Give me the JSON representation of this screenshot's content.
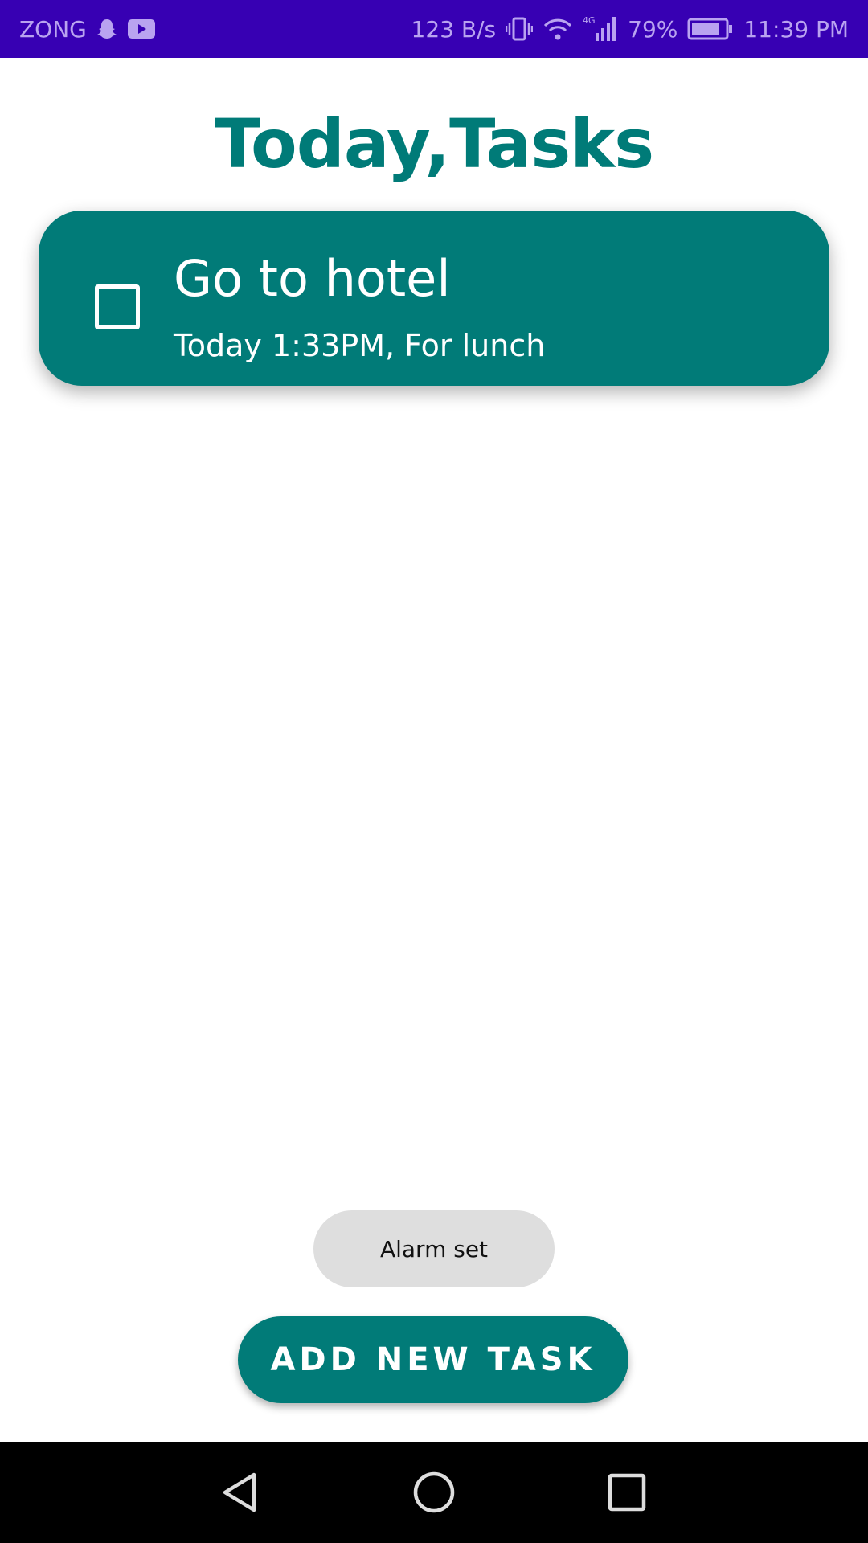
{
  "status_bar": {
    "carrier": "ZONG",
    "net_speed": "123 B/s",
    "network_type": "4G",
    "battery": "79%",
    "time": "11:39 PM",
    "icons": [
      "snapchat-icon",
      "youtube-icon",
      "vibrate-icon",
      "wifi-icon",
      "signal-icon",
      "battery-icon"
    ]
  },
  "header": {
    "title": "Today,Tasks"
  },
  "tasks": [
    {
      "title": "Go to hotel",
      "subtitle": "Today 1:33PM, For lunch",
      "checked": false
    }
  ],
  "toast": {
    "message": "Alarm set"
  },
  "actions": {
    "add_task_label": "ADD NEW TASK"
  },
  "nav_bar": {
    "icons": [
      "back-icon",
      "home-icon",
      "recents-icon"
    ]
  },
  "colors": {
    "status_bar": "#3700b3",
    "accent": "#017b78",
    "toast_bg": "#dedede",
    "nav_bar": "#000000"
  }
}
